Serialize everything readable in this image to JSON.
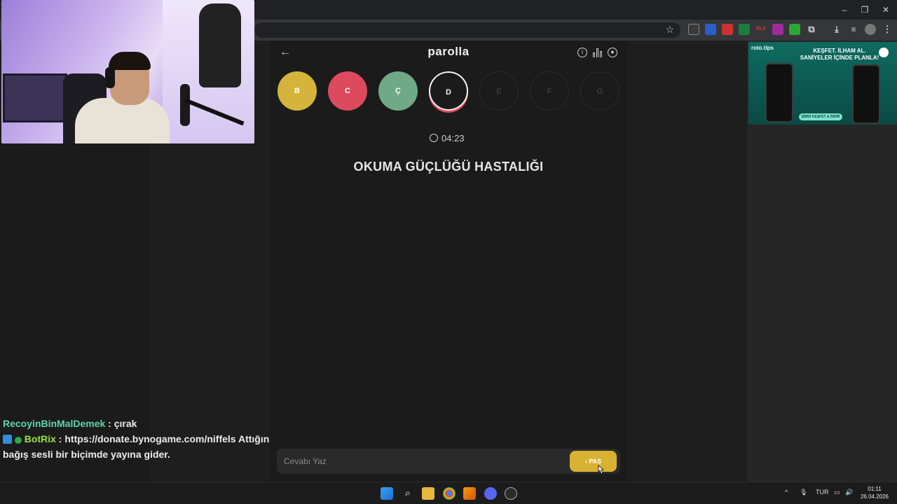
{
  "browser": {
    "window_controls": [
      "–",
      "❐",
      "✕"
    ],
    "bookmark_icon": "star-icon"
  },
  "game": {
    "brand": "parolla",
    "letters": [
      {
        "label": "B",
        "state": "answered",
        "color": "#d4b43a"
      },
      {
        "label": "C",
        "state": "wrong",
        "color": "#dd4a5e"
      },
      {
        "label": "Ç",
        "state": "answered",
        "color": "#6fa985"
      },
      {
        "label": "D",
        "state": "current",
        "color": "#1b1b1b"
      },
      {
        "label": "E",
        "state": "future",
        "color": "#1b1b1b"
      },
      {
        "label": "F",
        "state": "future",
        "color": "#1b1b1b"
      },
      {
        "label": "G",
        "state": "future",
        "color": "#1b1b1b"
      }
    ],
    "timer": "04:23",
    "question": "OKUMA GÜÇLÜĞÜ HASTALIĞI",
    "answer_placeholder": "Cevabı Yaz",
    "pass_label": "PAS"
  },
  "chat": {
    "messages": [
      {
        "user": "RecoyinBinMalDemek",
        "text": ": çırak"
      },
      {
        "user": "BotRix",
        "text": ": https://donate.bynogame.com/niffels Attığınız bağış sesli bir biçimde yayına gider."
      }
    ]
  },
  "ad": {
    "logo": "roto.tips",
    "headline": "KEŞFET. İLHAM AL. SANİYELER İÇİNDE PLANLA!",
    "cta": "ŞİMDİ KEŞFET & İNDİR"
  },
  "taskbar": {
    "language": "TUR",
    "time": "01:11",
    "date": "26.04.2026"
  }
}
